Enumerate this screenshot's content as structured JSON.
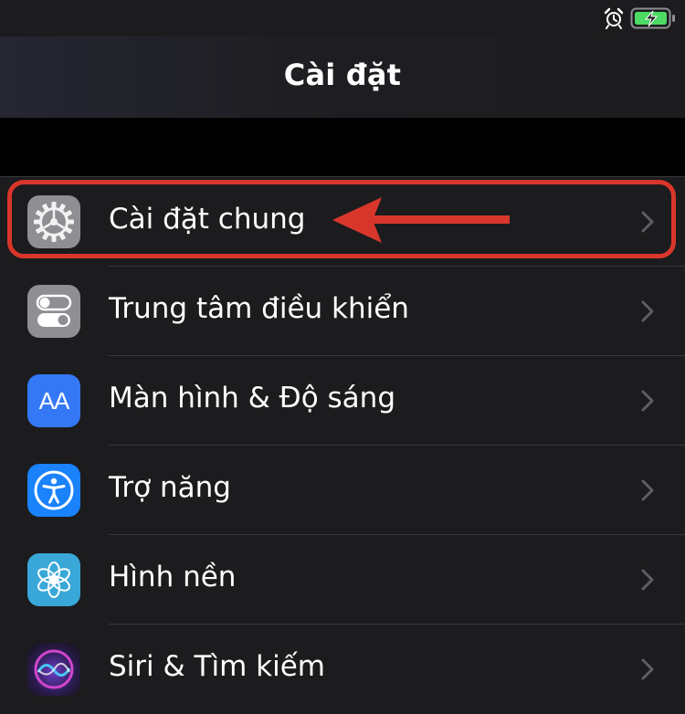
{
  "nav": {
    "title": "Cài đặt"
  },
  "status": {
    "icons": [
      "alarm-icon",
      "battery-charging-icon"
    ]
  },
  "settings": {
    "items": [
      {
        "label": "Cài đặt chung",
        "icon": "gear-icon",
        "color": "#8e8e93"
      },
      {
        "label": "Trung tâm điều khiển",
        "icon": "toggles-icon",
        "color": "#8e8e93"
      },
      {
        "label": "Màn hình & Độ sáng",
        "icon": "text-size-icon",
        "color": "#3478f6"
      },
      {
        "label": "Trợ năng",
        "icon": "accessibility-icon",
        "color": "#1a82fb"
      },
      {
        "label": "Hình nền",
        "icon": "wallpaper-flower-icon",
        "color": "#39a7d8"
      },
      {
        "label": "Siri & Tìm kiếm",
        "icon": "siri-icon",
        "color": "#2a1b4e"
      }
    ],
    "icon_glyphs": {
      "text_size": "AA"
    }
  },
  "colors": {
    "highlight": "#d9362b",
    "battery": "#4cd964"
  }
}
